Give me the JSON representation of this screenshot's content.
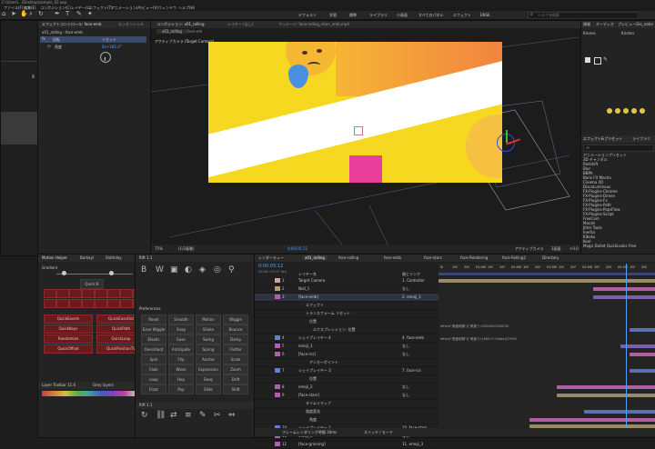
{
  "titlebar": {
    "path": "C:\\Users\\...\\Desktop\\sample_02.aep"
  },
  "menubar": [
    "ファイル(F)",
    "編集(E)",
    "コンポジション(C)",
    "レイヤー(L)",
    "エフェクト(T)",
    "アニメーション(A)",
    "ビュー(V)",
    "ウィンドウ",
    "ヘルプ(H)"
  ],
  "toolbar": {
    "modes": [
      "デフォルト",
      "学習",
      "標準",
      "ライブラリ",
      "小画面",
      "すべてのパネル",
      "エフェクト",
      "ENSE"
    ],
    "search_placeholder": "ヘルプを検索"
  },
  "effect_controls": {
    "tab_label": "エフェクトコントロール: face-emb",
    "title": "x01_rolling・face-emb",
    "effect_name": "回転",
    "property": "角度",
    "value_label": "リセット",
    "value": "0x+185.0°",
    "tab2": "エッセンシャル"
  },
  "comp_viewer": {
    "tab_label": "コンポジション: x01_rolling",
    "tab2": "レイヤー (なし)",
    "tab3": "フッテージ: face-rolling_stars_emb.mp4",
    "breadcrumb_active": "x01_rolling",
    "breadcrumb_other": "face-em",
    "camera_label": "アクティブカメラ (Target Camera)",
    "footer": {
      "zoom": "75%",
      "resolution": "(1/2画質)",
      "timecode": "0;00;05;12",
      "camera": "アクティブカメラ",
      "views": "1画面",
      "plus": "+0.0"
    }
  },
  "right_panel": {
    "tabs": [
      "情報",
      "オーディオ",
      "プレビュー",
      "Glo_nator"
    ],
    "font_label": "Krones",
    "font_style": "Kristen",
    "fill_label": "塗り",
    "stroke_label": "線",
    "type_label": "フォント",
    "ep_tab": "エフェクト&プリセット",
    "ep_tab2": "ライブラリ",
    "search_placeholder": "ハ",
    "items": [
      "アニメーションプリセット",
      "3D チャンネル",
      "Redshift",
      "Blur",
      "BBPA",
      "Boris FX Mocha",
      "Cinema 4D",
      "DiscoLuminous",
      "FX-Plugins-Chrome",
      "FX-Plugins-Dimen",
      "FX-Plugins-Fx",
      "FX-Plugins-Path",
      "FX-Plugins-PopsFlow",
      "FX-Plugins-Script",
      "FreeCam",
      "Mocah",
      "Jitter Tools",
      "Inertia",
      "Kibaku",
      "Kool",
      "Magic Bullet QuickLooks Free"
    ]
  },
  "left_bottom": {
    "tabs": [
      "Motion Helper",
      "Barkeyl",
      "Slothday"
    ],
    "label_a": "Gradient",
    "label_b": "Quick B",
    "buttons": [
      "QuickEaseIn",
      "QuickEaseOut",
      "QuickKeys",
      "QuickPath",
      "Randomize",
      "QuickLoop",
      "QuickOffset",
      "QuickPositionTV"
    ],
    "footer_title": "Layer Toolbar 11.6",
    "footer_tab": "Grey layers"
  },
  "mid_bottom": {
    "tab": "Rift 1.1",
    "sub_tab": "Preferences",
    "buttons": [
      "Reset",
      "Smooth",
      "Motion",
      "Wiggle",
      "Ease Wiggle",
      "Snap",
      "Shake",
      "Bounce",
      "Elastic",
      "Ease",
      "Swing",
      "Damp",
      "Overshoot",
      "Anticipate",
      "Spring",
      "Flutter",
      "Spin",
      "Flip",
      "Anchor",
      "Scale",
      "Fade",
      "Wave",
      "Expression",
      "Zoom",
      "Loop",
      "Hop",
      "Sway",
      "Drift",
      "Float",
      "Pop",
      "Slide",
      "Shift",
      "Tilt",
      "Roll",
      "Blink",
      "Punch"
    ],
    "tab2": "Rift 1.1"
  },
  "timeline": {
    "tabs": [
      "レンダーキュー",
      "x01_rolling",
      "face-rolling",
      "face-emb",
      "face-stars",
      "face-Rendering",
      "face-Rolling2",
      "Directory"
    ],
    "timecode": "0;00;05;12",
    "frame_info": "00162 (29.97 fps)",
    "col_source": "レイヤー名",
    "col_parent": "親とリンク",
    "footer_label": "フレームレンダリング時間 30ms",
    "footer_switch": "スイッチ / モード",
    "rows": [
      {
        "num": "1",
        "name": "Target Camera",
        "color": "#d9a0a0",
        "parent": "1. Controller"
      },
      {
        "num": "2",
        "name": "Null_1",
        "color": "#b0a070",
        "parent": "なし"
      },
      {
        "num": "3",
        "name": "[face-emb]",
        "color": "#b060b0",
        "parent": "2. emoji_1"
      },
      {
        "num": "",
        "name": "エフェクト",
        "color": "",
        "parent": ""
      },
      {
        "num": "",
        "name": "トランスフォーム リセット",
        "color": "",
        "parent": ""
      },
      {
        "num": "",
        "name": "位置",
        "color": "",
        "parent": ""
      },
      {
        "num": "",
        "name": "エクスプレッション: 位置",
        "color": "",
        "parent": ""
      },
      {
        "num": "4",
        "name": "シェイプレイヤー 4",
        "color": "#6080d0",
        "parent": "4. face-emb"
      },
      {
        "num": "5",
        "name": "emoji_1",
        "color": "#b060b0",
        "parent": "なし"
      },
      {
        "num": "6",
        "name": "[face-rcs]",
        "color": "#b060b0",
        "parent": "なし"
      },
      {
        "num": "",
        "name": "アンカーポイント",
        "color": "",
        "parent": ""
      },
      {
        "num": "7",
        "name": "シェイプレイヤー 3",
        "color": "#6080d0",
        "parent": "7. face-rcs"
      },
      {
        "num": "",
        "name": "位置",
        "color": "",
        "parent": ""
      },
      {
        "num": "8",
        "name": "emoji_2",
        "color": "#b060b0",
        "parent": "なし"
      },
      {
        "num": "9",
        "name": "[face-stars]",
        "color": "#b060b0",
        "parent": "なし"
      },
      {
        "num": "",
        "name": "タイムリマップ",
        "color": "",
        "parent": ""
      },
      {
        "num": "",
        "name": "角度変化",
        "color": "",
        "parent": ""
      },
      {
        "num": "",
        "name": "角度",
        "color": "",
        "parent": ""
      },
      {
        "num": "10",
        "name": "シェイプレイヤー 2",
        "color": "#6080d0",
        "parent": "10. face-stars"
      },
      {
        "num": "11",
        "name": "emoji_3",
        "color": "#b060b0",
        "parent": "なし"
      },
      {
        "num": "12",
        "name": "[face-grinning]",
        "color": "#b060b0",
        "parent": "11. emoji_3"
      },
      {
        "num": "",
        "name": "タイムリマップ",
        "color": "",
        "parent": ""
      }
    ],
    "ruler": [
      "0f",
      "10f",
      "20f",
      "01:00f",
      "10f",
      "20f",
      "02:00f",
      "10f",
      "20f",
      "03:00f",
      "10f",
      "20f",
      "04:00f",
      "10f",
      "20f",
      "05:00f",
      "10f",
      "20f"
    ],
    "expressions": [
      "effect(\"角度制御\")(\"角度\")+200000/2030/30",
      "effect(\"角度制御\")(\"角度\")+(360+C+Date)/2*500"
    ],
    "colors": {
      "pink": "#b060a0",
      "purple": "#7a5fb0",
      "tan": "#9a8a6a",
      "blue": "#5a70b0",
      "accent": "#4aa3ff"
    }
  }
}
